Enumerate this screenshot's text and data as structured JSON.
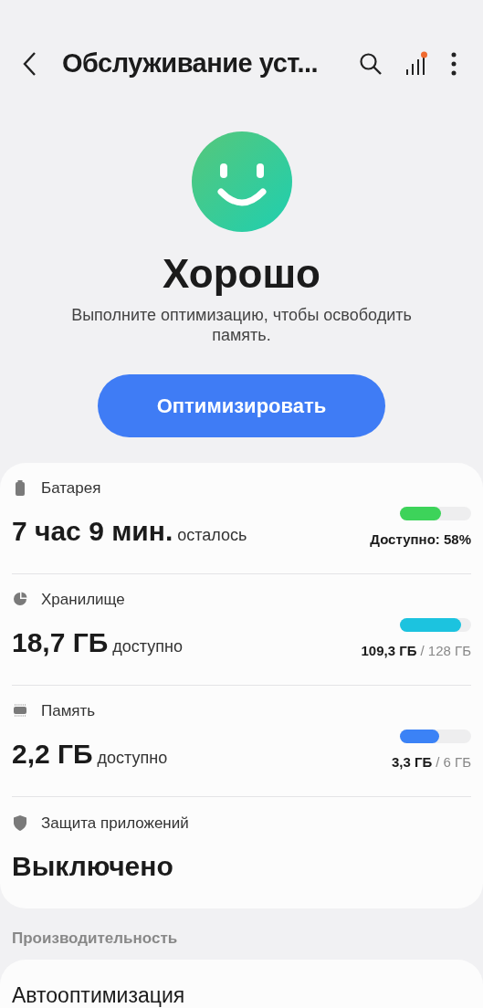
{
  "header": {
    "title": "Обслуживание уст..."
  },
  "status": {
    "title": "Хорошо",
    "description": "Выполните оптимизацию, чтобы освободить память."
  },
  "optimize_button": {
    "label": "Оптимизировать"
  },
  "items": [
    {
      "kind": "battery",
      "label": "Батарея",
      "value": "7 час 9 мин.",
      "suffix": "осталось",
      "level": 0.58,
      "color": "#3dd35a",
      "reading": "Доступно: 58%"
    },
    {
      "kind": "storage",
      "label": "Хранилище",
      "value": "18,7 ГБ",
      "suffix": "доступно",
      "level": 0.86,
      "color": "#1cc3df",
      "used": "109,3 ГБ",
      "total": "/ 128 ГБ"
    },
    {
      "kind": "memory",
      "label": "Память",
      "value": "2,2 ГБ",
      "suffix": "доступно",
      "level": 0.55,
      "color": "#3b82f6",
      "used": "3,3 ГБ",
      "total": "/ 6 ГБ"
    },
    {
      "kind": "protection",
      "label": "Защита приложений",
      "value": "Выключено"
    }
  ],
  "section": {
    "title": "Производительность",
    "items": [
      {
        "title": "Автооптимизация"
      }
    ]
  }
}
